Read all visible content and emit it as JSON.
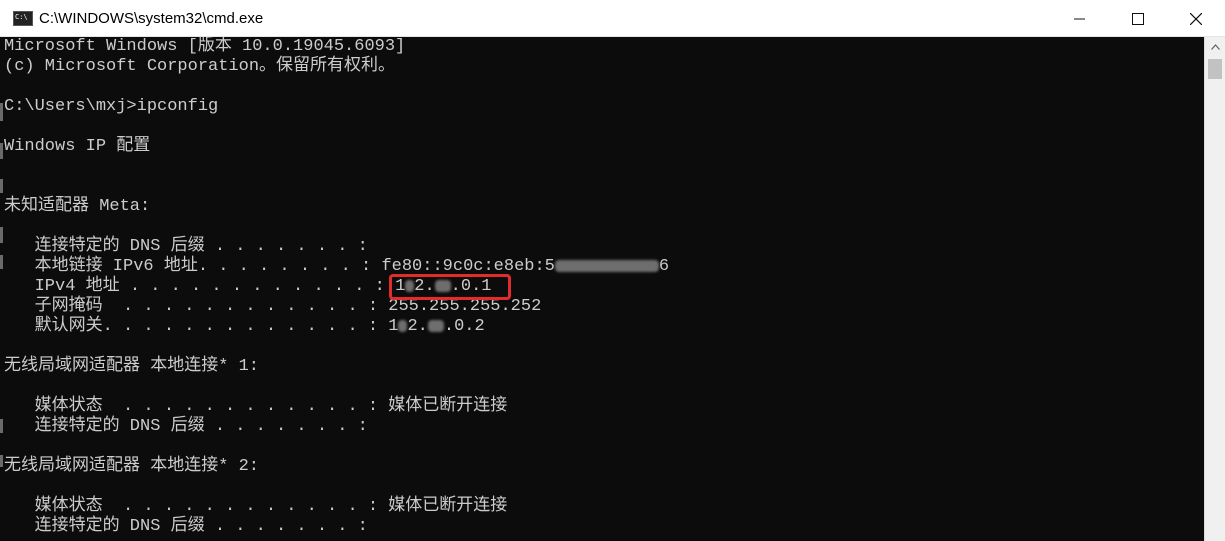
{
  "window": {
    "title": "C:\\WINDOWS\\system32\\cmd.exe",
    "icon_label": "C:\\",
    "controls": {
      "minimize": "—",
      "maximize": "☐",
      "close": "✕"
    }
  },
  "console": {
    "line_version": "Microsoft Windows [版本 10.0.19045.6093]",
    "line_copyright": "(c) Microsoft Corporation。保留所有权利。",
    "line_prompt": "C:\\Users\\mxj>ipconfig",
    "line_heading": "Windows IP 配置",
    "adapter_unknown": "未知适配器 Meta:",
    "dns_suffix_1": "   连接特定的 DNS 后缀 . . . . . . . :",
    "ipv6_label": "   本地链接 IPv6 地址. . . . . . . . : ",
    "ipv6_visible_start": "fe80::9c0c:e8eb:5",
    "ipv6_visible_end": "6",
    "ipv4_label": "   IPv4 地址 . . . . . . . . . . . . : ",
    "ipv4_visible_1": "1",
    "ipv4_visible_2": "2.",
    "ipv4_visible_3": ".0.1",
    "subnet_line": "   子网掩码  . . . . . . . . . . . . : 255.255.255.252",
    "gateway_label": "   默认网关. . . . . . . . . . . . . : ",
    "gateway_visible_1": "1",
    "gateway_visible_2": "2.",
    "gateway_visible_3": ".0.2",
    "wlan1_heading": "无线局域网适配器 本地连接* 1:",
    "wlan1_media": "   媒体状态  . . . . . . . . . . . . : 媒体已断开连接",
    "wlan1_dns": "   连接特定的 DNS 后缀 . . . . . . . :",
    "wlan2_heading": "无线局域网适配器 本地连接* 2:",
    "wlan2_media": "   媒体状态  . . . . . . . . . . . . : 媒体已断开连接",
    "wlan2_dns": "   连接特定的 DNS 后缀 . . . . . . . :"
  },
  "colors": {
    "console_bg": "#0c0c0c",
    "console_fg": "#cccccc",
    "highlight": "#e22b2b"
  },
  "icons": {
    "app": "cmd-icon",
    "scroll_up": "chevron-up-icon"
  }
}
